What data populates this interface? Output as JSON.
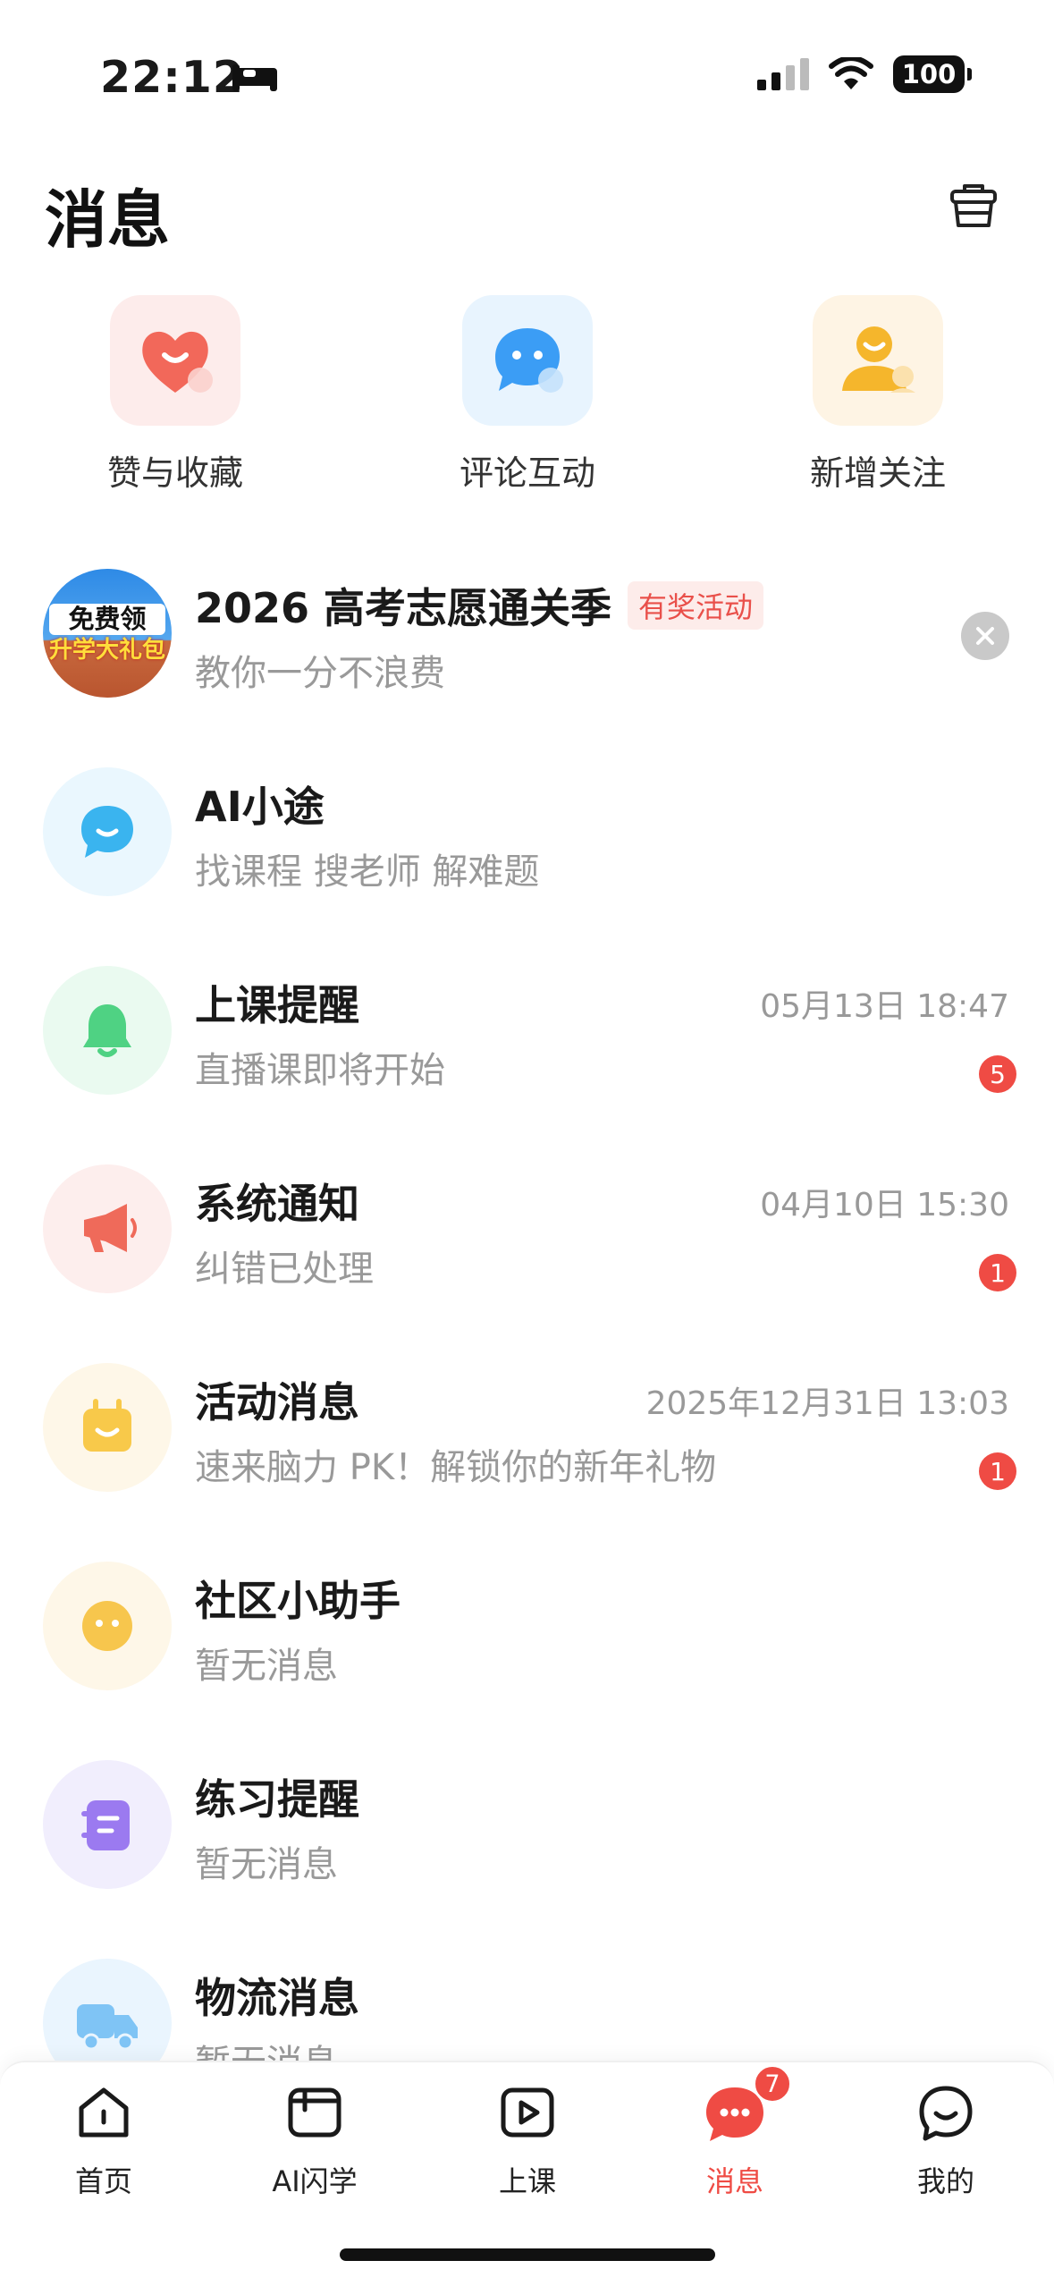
{
  "status_bar": {
    "time": "22:12",
    "battery": "100"
  },
  "header": {
    "title": "消息",
    "clear_icon": "clear-basket-icon"
  },
  "quick_entries": [
    {
      "label": "赞与收藏",
      "icon": "heart-icon",
      "color": "#f2685a"
    },
    {
      "label": "评论互动",
      "icon": "chat-bubble-icon",
      "color": "#3b9df5"
    },
    {
      "label": "新增关注",
      "icon": "person-add-icon",
      "color": "#f5b62c"
    }
  ],
  "promo": {
    "avatar_text_1": "免费领",
    "avatar_text_2": "升学大礼包",
    "title": "2026 高考志愿通关季",
    "tag": "有奖活动",
    "subtitle": "教你一分不浪费"
  },
  "messages": [
    {
      "title": "AI小途",
      "subtitle": "找课程 搜老师 解难题",
      "time": "",
      "badge": "",
      "icon": "ai-chat-icon",
      "color": "#3ab4ef",
      "bg": "#eaf7fe"
    },
    {
      "title": "上课提醒",
      "subtitle": "直播课即将开始",
      "time": "05月13日 18:47",
      "badge": "5",
      "icon": "bell-icon",
      "color": "#4fd283",
      "bg": "#eafaf0"
    },
    {
      "title": "系统通知",
      "subtitle": "纠错已处理",
      "time": "04月10日 15:30",
      "badge": "1",
      "icon": "megaphone-icon",
      "color": "#ef6a5a",
      "bg": "#fdeeed"
    },
    {
      "title": "活动消息",
      "subtitle": "速来脑力 PK！解锁你的新年礼物",
      "time": "2025年12月31日 13:03",
      "badge": "1",
      "icon": "gift-box-icon",
      "color": "#f8c94a",
      "bg": "#fef7e8"
    },
    {
      "title": "社区小助手",
      "subtitle": "暂无消息",
      "time": "",
      "badge": "",
      "icon": "smiley-icon",
      "color": "#f7c64d",
      "bg": "#fef7e8"
    },
    {
      "title": "练习提醒",
      "subtitle": "暂无消息",
      "time": "",
      "badge": "",
      "icon": "notebook-icon",
      "color": "#9b7af0",
      "bg": "#f1eefd"
    },
    {
      "title": "物流消息",
      "subtitle": "暂无消息",
      "time": "",
      "badge": "",
      "icon": "truck-icon",
      "color": "#7fc4f5",
      "bg": "#eaf5fe"
    }
  ],
  "tab_bar": [
    {
      "label": "首页",
      "icon": "home-icon",
      "active": false,
      "badge": ""
    },
    {
      "label": "AI闪学",
      "icon": "book-icon",
      "active": false,
      "badge": ""
    },
    {
      "label": "上课",
      "icon": "play-icon",
      "active": false,
      "badge": ""
    },
    {
      "label": "消息",
      "icon": "message-icon",
      "active": true,
      "badge": "7"
    },
    {
      "label": "我的",
      "icon": "profile-icon",
      "active": false,
      "badge": ""
    }
  ],
  "colors": {
    "accent": "#ef4b44",
    "muted_text": "#999999"
  }
}
